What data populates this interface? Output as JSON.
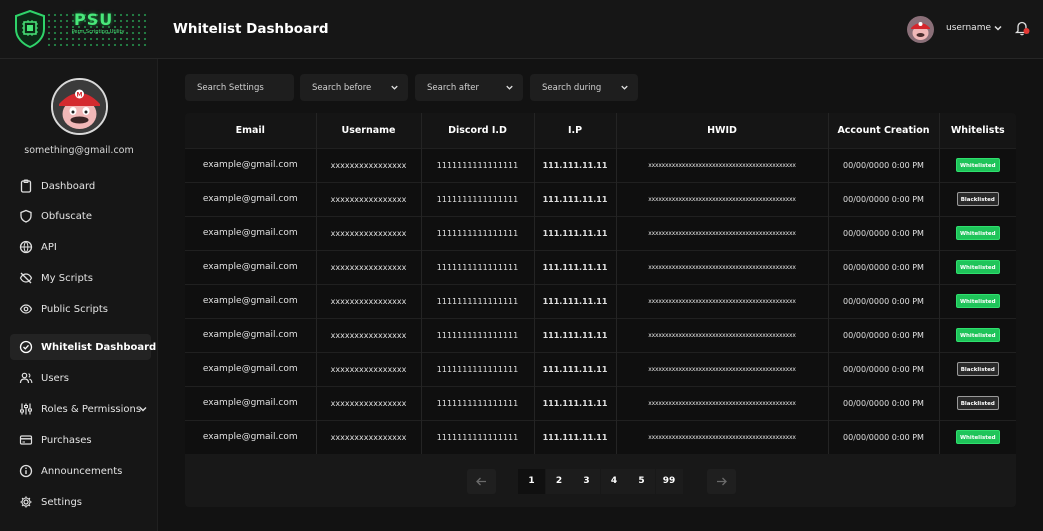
{
  "header": {
    "logo_title": "PSU",
    "logo_subtitle": "Perm Scripting Utility",
    "page_title": "Whitelist Dashboard",
    "username": "username"
  },
  "sidebar": {
    "email": "something@gmail.com",
    "items": [
      {
        "label": "Dashboard",
        "icon": "clipboard-icon"
      },
      {
        "label": "Obfuscate",
        "icon": "shield-icon"
      },
      {
        "label": "API",
        "icon": "globe-icon"
      },
      {
        "label": "My Scripts",
        "icon": "eye-off-icon"
      },
      {
        "label": "Public Scripts",
        "icon": "eye-icon"
      },
      {
        "label": "Whitelist Dashboard",
        "icon": "check-circle-icon",
        "active": true
      },
      {
        "label": "Users",
        "icon": "users-icon"
      },
      {
        "label": "Roles & Permissions",
        "icon": "sliders-icon"
      },
      {
        "label": "Purchases",
        "icon": "credit-card-icon"
      },
      {
        "label": "Announcements",
        "icon": "info-icon"
      },
      {
        "label": "Settings",
        "icon": "gear-icon"
      }
    ]
  },
  "filters": {
    "search_settings": "Search Settings",
    "search_before": "Search before",
    "search_after": "Search after",
    "search_during": "Search during"
  },
  "table": {
    "columns": [
      "Email",
      "Username",
      "Discord I.D",
      "I.P",
      "HWID",
      "Account Creation",
      "Whitelists"
    ],
    "rows": [
      {
        "email": "example@gmail.com",
        "username": "xxxxxxxxxxxxxxxx",
        "discord": "1111111111111111",
        "ip": "111.111.11.11",
        "hwid": "xxxxxxxxxxxxxxxxxxxxxxxxxxxxxxxxxxxxxxxxxxxx",
        "created": "00/00/0000 0:00 PM",
        "status": "Whitelisted"
      },
      {
        "email": "example@gmail.com",
        "username": "xxxxxxxxxxxxxxxx",
        "discord": "1111111111111111",
        "ip": "111.111.11.11",
        "hwid": "xxxxxxxxxxxxxxxxxxxxxxxxxxxxxxxxxxxxxxxxxxxx",
        "created": "00/00/0000 0:00 PM",
        "status": "Blacklisted"
      },
      {
        "email": "example@gmail.com",
        "username": "xxxxxxxxxxxxxxxx",
        "discord": "1111111111111111",
        "ip": "111.111.11.11",
        "hwid": "xxxxxxxxxxxxxxxxxxxxxxxxxxxxxxxxxxxxxxxxxxxx",
        "created": "00/00/0000 0:00 PM",
        "status": "Whitelisted"
      },
      {
        "email": "example@gmail.com",
        "username": "xxxxxxxxxxxxxxxx",
        "discord": "1111111111111111",
        "ip": "111.111.11.11",
        "hwid": "xxxxxxxxxxxxxxxxxxxxxxxxxxxxxxxxxxxxxxxxxxxx",
        "created": "00/00/0000 0:00 PM",
        "status": "Whitelisted"
      },
      {
        "email": "example@gmail.com",
        "username": "xxxxxxxxxxxxxxxx",
        "discord": "1111111111111111",
        "ip": "111.111.11.11",
        "hwid": "xxxxxxxxxxxxxxxxxxxxxxxxxxxxxxxxxxxxxxxxxxxx",
        "created": "00/00/0000 0:00 PM",
        "status": "Whitelisted"
      },
      {
        "email": "example@gmail.com",
        "username": "xxxxxxxxxxxxxxxx",
        "discord": "1111111111111111",
        "ip": "111.111.11.11",
        "hwid": "xxxxxxxxxxxxxxxxxxxxxxxxxxxxxxxxxxxxxxxxxxxx",
        "created": "00/00/0000 0:00 PM",
        "status": "Whitelisted"
      },
      {
        "email": "example@gmail.com",
        "username": "xxxxxxxxxxxxxxxx",
        "discord": "1111111111111111",
        "ip": "111.111.11.11",
        "hwid": "xxxxxxxxxxxxxxxxxxxxxxxxxxxxxxxxxxxxxxxxxxxx",
        "created": "00/00/0000 0:00 PM",
        "status": "Blacklisted"
      },
      {
        "email": "example@gmail.com",
        "username": "xxxxxxxxxxxxxxxx",
        "discord": "1111111111111111",
        "ip": "111.111.11.11",
        "hwid": "xxxxxxxxxxxxxxxxxxxxxxxxxxxxxxxxxxxxxxxxxxxx",
        "created": "00/00/0000 0:00 PM",
        "status": "Blacklisted"
      },
      {
        "email": "example@gmail.com",
        "username": "xxxxxxxxxxxxxxxx",
        "discord": "1111111111111111",
        "ip": "111.111.11.11",
        "hwid": "xxxxxxxxxxxxxxxxxxxxxxxxxxxxxxxxxxxxxxxxxxxx",
        "created": "00/00/0000 0:00 PM",
        "status": "Whitelisted"
      }
    ]
  },
  "pagination": {
    "pages": [
      "1",
      "2",
      "3",
      "4",
      "5",
      "99"
    ],
    "current": "1"
  },
  "colors": {
    "accent_green": "#1fc45a",
    "background": "#121212",
    "panel": "#161616"
  }
}
